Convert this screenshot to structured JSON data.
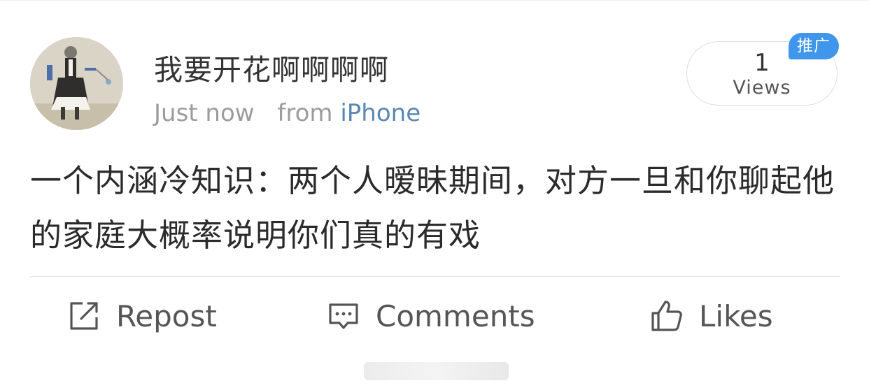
{
  "post": {
    "username": "我要开花啊啊啊啊",
    "time": "Just now",
    "from_label": "from",
    "source": "iPhone",
    "views_count": "1",
    "views_label": "Views",
    "promo_badge": "推广",
    "text": "一个内涵冷知识：两个人暧昧期间，对方一旦和你聊起他的家庭大概率说明你们真的有戏"
  },
  "actions": {
    "repost_label": "Repost",
    "comments_label": "Comments",
    "likes_label": "Likes"
  },
  "icons": {
    "repost": "edit-square-icon",
    "comments": "comment-bubble-icon",
    "likes": "thumbs-up-icon"
  },
  "colors": {
    "source_link": "#5a87b4",
    "badge": "#3f96ea",
    "text": "#2b2b2b",
    "meta": "#9c9c9c"
  }
}
